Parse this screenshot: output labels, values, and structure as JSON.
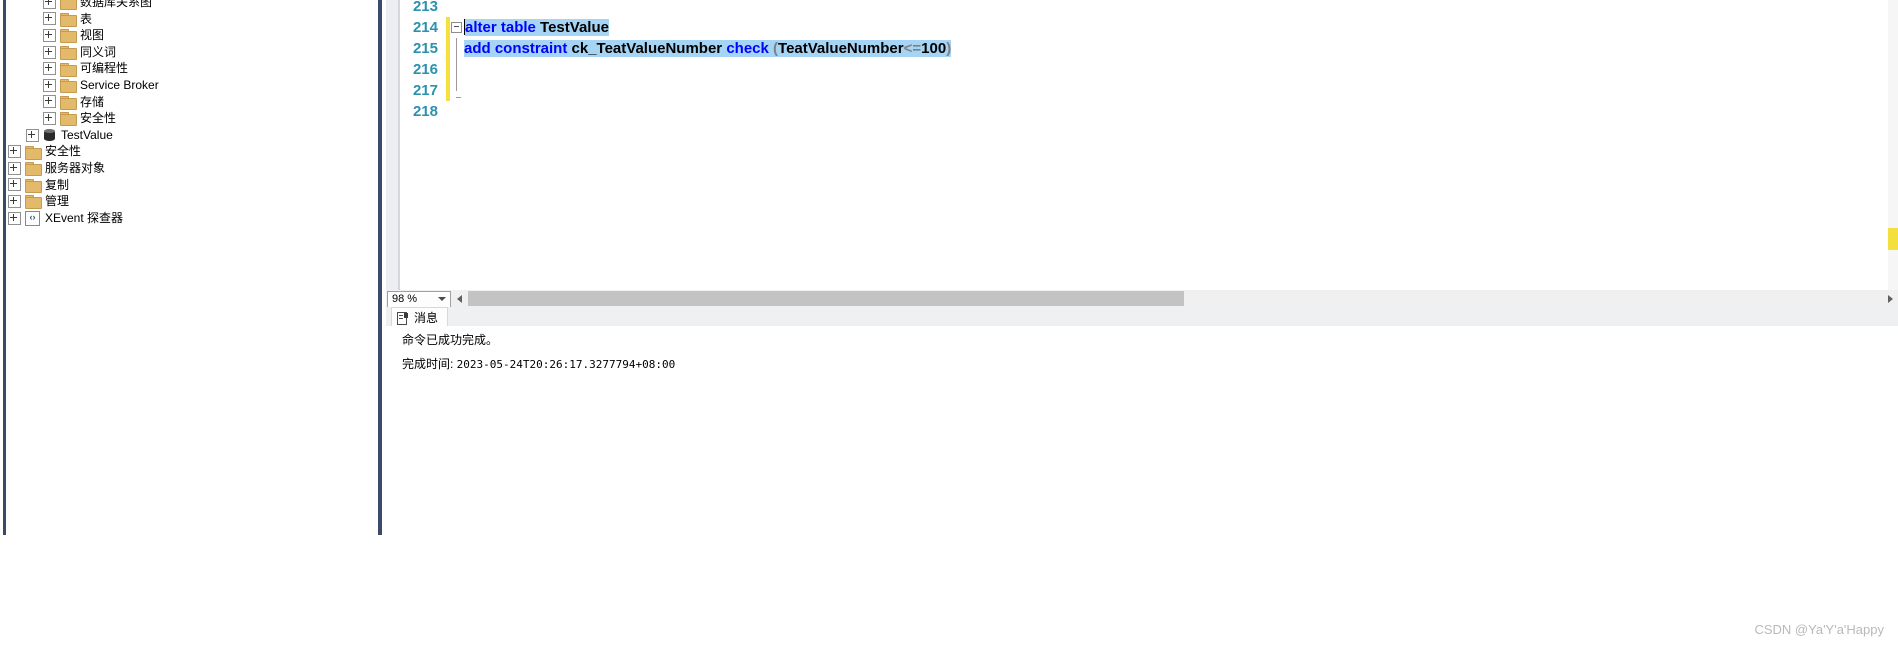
{
  "object_explorer": {
    "name": "Object Explorer",
    "nodes": [
      {
        "label": "数据库关系图",
        "icon": "folder-icon",
        "indent": 3,
        "expander": "plus"
      },
      {
        "label": "表",
        "icon": "folder-icon",
        "indent": 3,
        "expander": "plus"
      },
      {
        "label": "视图",
        "icon": "folder-icon",
        "indent": 3,
        "expander": "plus"
      },
      {
        "label": "同义词",
        "icon": "folder-icon",
        "indent": 3,
        "expander": "plus"
      },
      {
        "label": "可编程性",
        "icon": "folder-icon",
        "indent": 3,
        "expander": "plus"
      },
      {
        "label": "Service Broker",
        "icon": "folder-icon",
        "indent": 3,
        "expander": "plus"
      },
      {
        "label": "存储",
        "icon": "folder-icon",
        "indent": 3,
        "expander": "plus"
      },
      {
        "label": "安全性",
        "icon": "folder-icon",
        "indent": 3,
        "expander": "plus"
      },
      {
        "label": "TestValue",
        "icon": "database-icon",
        "indent": 2,
        "expander": "plus"
      },
      {
        "label": "安全性",
        "icon": "folder-icon",
        "indent": 1,
        "expander": "plus"
      },
      {
        "label": "服务器对象",
        "icon": "folder-icon",
        "indent": 1,
        "expander": "plus"
      },
      {
        "label": "复制",
        "icon": "folder-icon",
        "indent": 1,
        "expander": "plus"
      },
      {
        "label": "管理",
        "icon": "folder-icon",
        "indent": 1,
        "expander": "plus"
      },
      {
        "label": "XEvent 探查器",
        "icon": "xevent-icon",
        "indent": 1,
        "expander": "plus"
      }
    ]
  },
  "editor": {
    "name": "SQL query editor",
    "lines": [
      {
        "number": "213",
        "segments": []
      },
      {
        "number": "214",
        "segments": [
          {
            "text": "alter table ",
            "kind": "keyword",
            "selected": true
          },
          {
            "text": "TestValue",
            "kind": "plain",
            "selected": true
          }
        ]
      },
      {
        "number": "215",
        "segments": [
          {
            "text": "add constraint ",
            "kind": "keyword",
            "selected": true
          },
          {
            "text": "ck_TeatValueNumber ",
            "kind": "plain",
            "selected": true
          },
          {
            "text": "check ",
            "kind": "keyword",
            "selected": true
          },
          {
            "text": "(",
            "kind": "paren",
            "selected": true
          },
          {
            "text": "TeatValueNumber",
            "kind": "plain",
            "selected": true
          },
          {
            "text": "<=",
            "kind": "operator",
            "selected": true
          },
          {
            "text": "100",
            "kind": "plain",
            "selected": true
          },
          {
            "text": ")",
            "kind": "paren",
            "selected": true
          }
        ]
      },
      {
        "number": "216",
        "segments": []
      },
      {
        "number": "217",
        "segments": []
      },
      {
        "number": "218",
        "segments": []
      }
    ],
    "full_text_line_214": "alter table TestValue",
    "full_text_line_215": "add constraint ck_TeatValueNumber check (TeatValueNumber<=100)",
    "zoom_level": "98 %",
    "colors": {
      "keyword": "#0000ff",
      "line_number": "#2b91af",
      "selection": "#a6d4f5",
      "change_bar": "#f5e03c"
    }
  },
  "messages": {
    "tab_label": "消息",
    "tab_icon": "messages-icon",
    "line_1": "命令已成功完成。",
    "line_2_label": "完成时间: ",
    "line_2_value": "2023-05-24T20:26:17.3277794+08:00"
  },
  "watermark": {
    "text": "CSDN @Ya'Y'a'Happy"
  }
}
